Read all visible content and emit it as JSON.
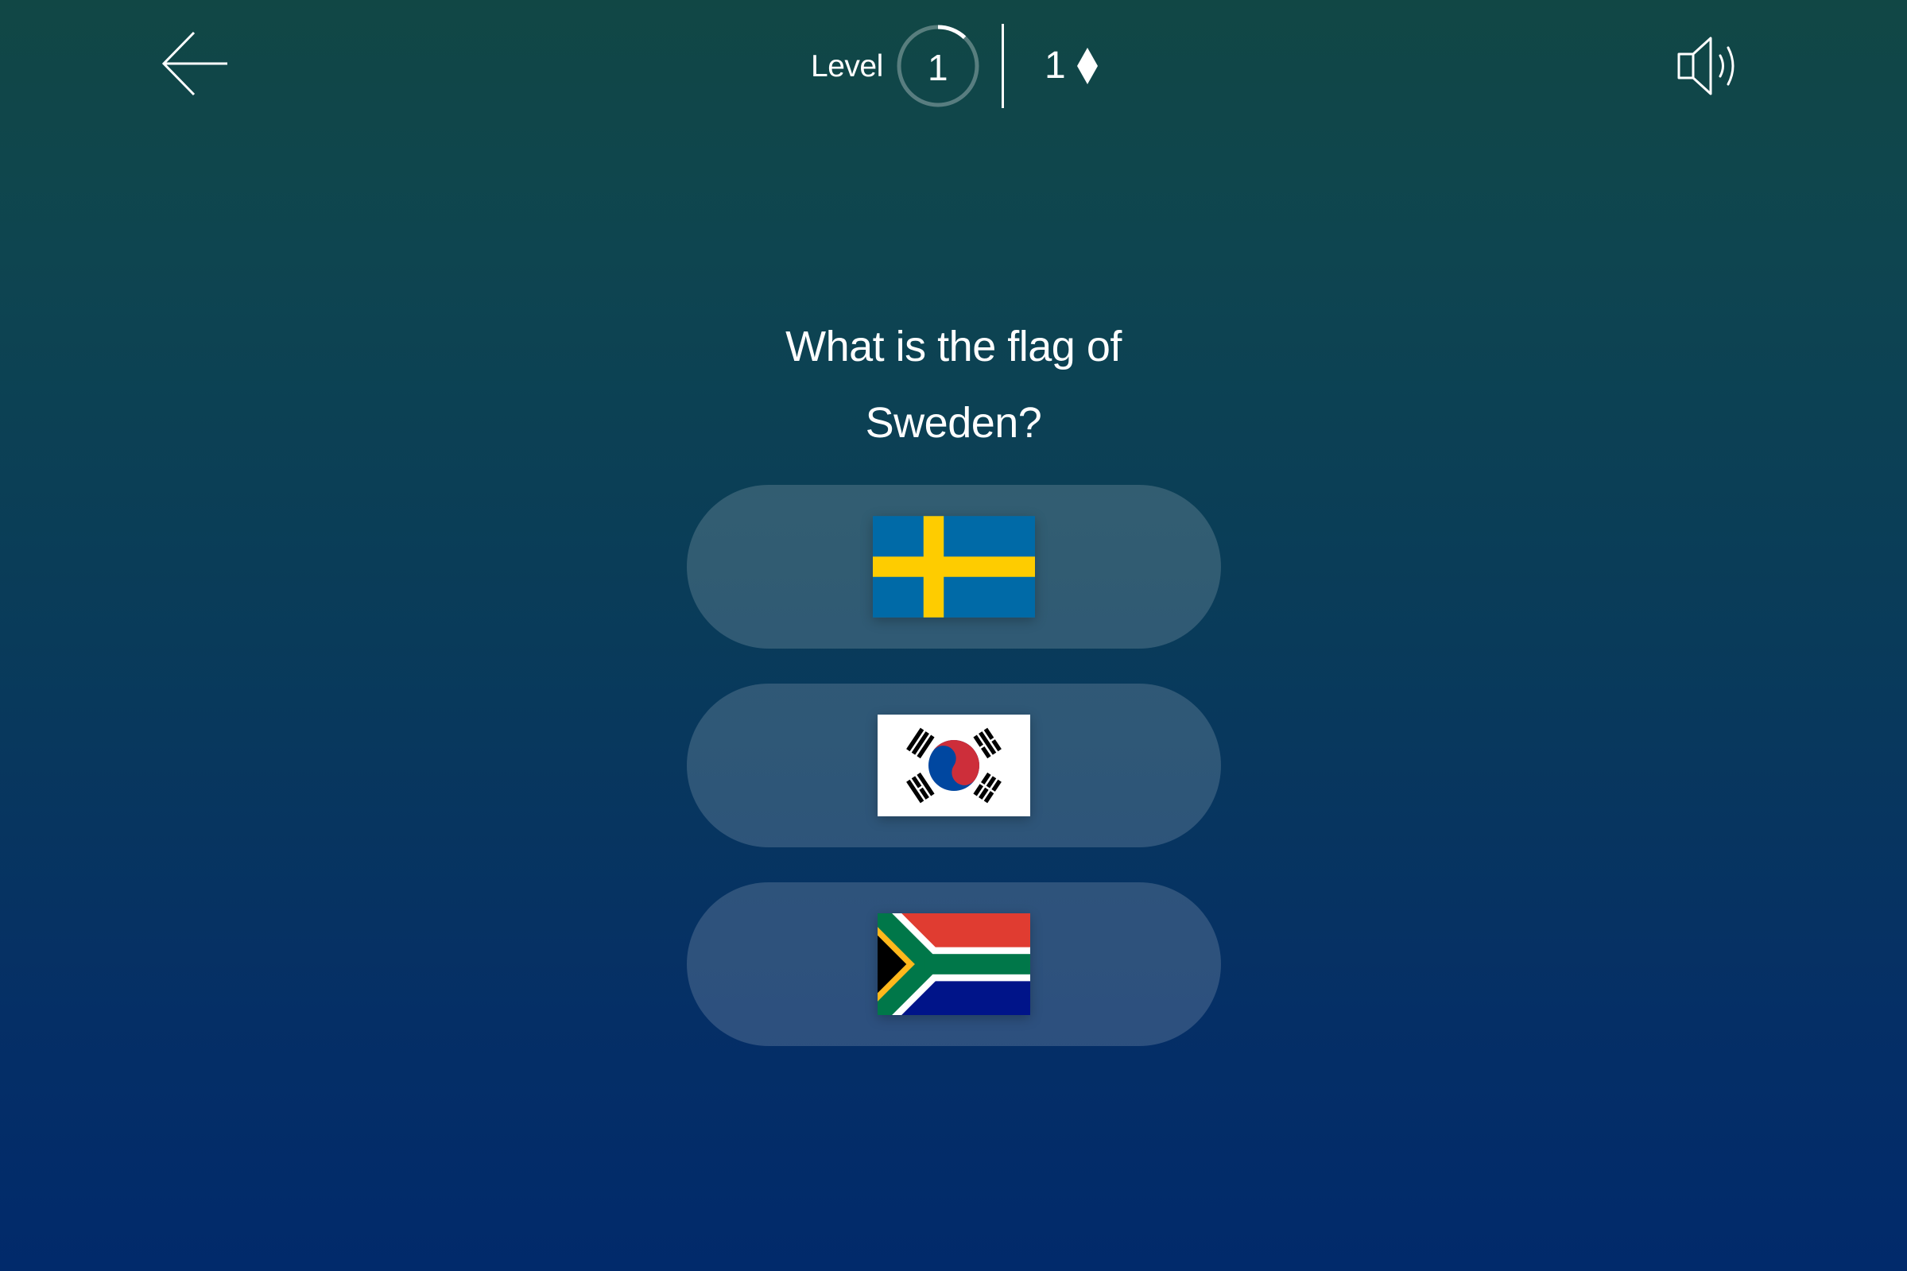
{
  "header": {
    "back_icon": "arrow-left-icon",
    "level_label": "Level",
    "level_number": "1",
    "level_progress": 0.12,
    "gem_count": "1",
    "gem_icon": "diamond-icon",
    "sound_icon": "speaker-icon"
  },
  "question": {
    "line1": "What is the flag of",
    "line2": "Sweden?"
  },
  "answers": [
    {
      "flag": "sweden-flag"
    },
    {
      "flag": "south-korea-flag"
    },
    {
      "flag": "south-africa-flag"
    }
  ],
  "colors": {
    "background_top": "#114745",
    "background_bottom": "#012a6b",
    "answer_pill": "rgba(255,255,255,0.16)",
    "text": "#ffffff"
  }
}
